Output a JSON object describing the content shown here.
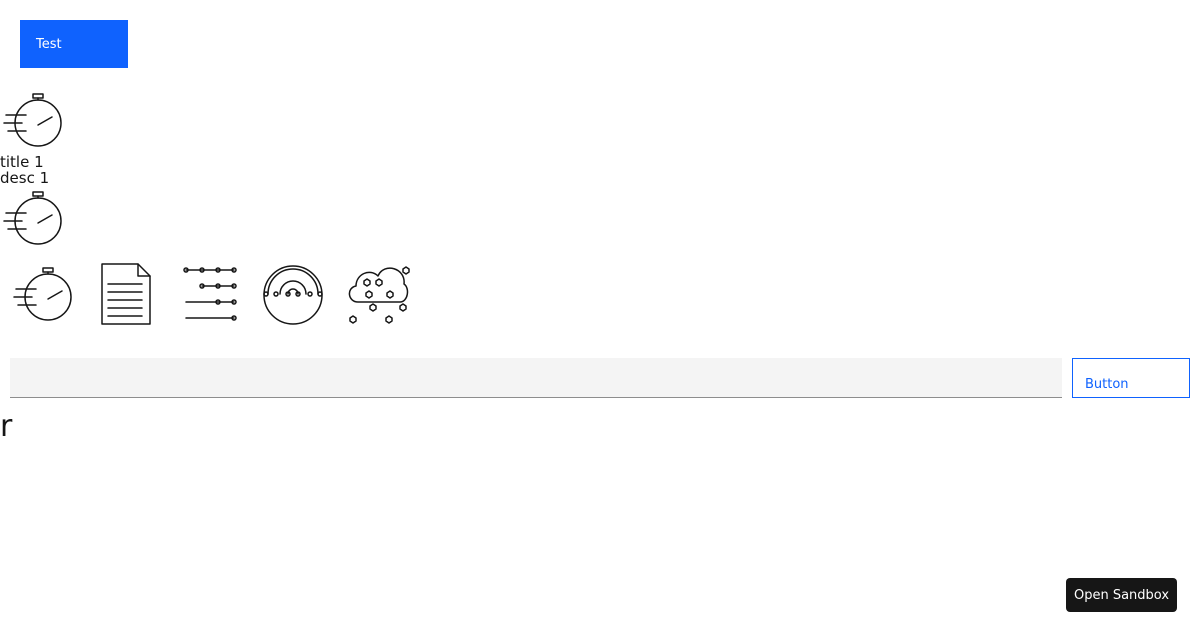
{
  "test_button": {
    "label": "Test"
  },
  "tile": {
    "title": "title 1",
    "description": "desc 1"
  },
  "icons": {
    "stopwatch": "stopwatch-icon",
    "document": "document-icon",
    "sliders": "sliders-icon",
    "gauge": "gauge-icon",
    "cloud_data": "cloud-data-icon"
  },
  "form": {
    "input_value": "",
    "button_label": "Button"
  },
  "stray_glyph": "r",
  "sandbox": {
    "label": "Open Sandbox"
  },
  "colors": {
    "primary": "#0f62fe",
    "text": "#161616",
    "field_background": "#f4f4f4",
    "field_border": "#8d8d8d",
    "sandbox_background": "#161616"
  }
}
